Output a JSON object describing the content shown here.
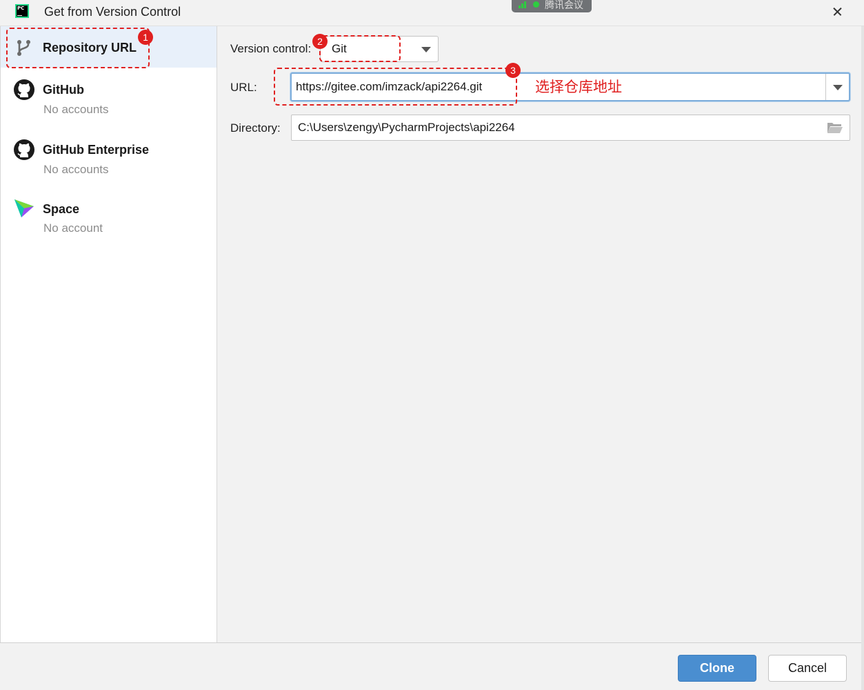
{
  "window": {
    "title": "Get from Version Control",
    "app_icon_text": "PC"
  },
  "overlay": {
    "meeting_label": "腾讯会议"
  },
  "sidebar": {
    "items": [
      {
        "label": "Repository URL",
        "sub": "",
        "icon": "vcs-branch-icon",
        "selected": true
      },
      {
        "label": "GitHub",
        "sub": "No accounts",
        "icon": "github-icon",
        "selected": false
      },
      {
        "label": "GitHub Enterprise",
        "sub": "No accounts",
        "icon": "github-icon",
        "selected": false
      },
      {
        "label": "Space",
        "sub": "No account",
        "icon": "space-icon",
        "selected": false
      }
    ]
  },
  "form": {
    "version_control_label": "Version control:",
    "version_control_value": "Git",
    "url_label": "URL:",
    "url_value": "https://gitee.com/imzack/api2264.git",
    "directory_label": "Directory:",
    "directory_value": "C:\\Users\\zengy\\PycharmProjects\\api2264"
  },
  "annotations": {
    "markers": [
      "1",
      "2",
      "3"
    ],
    "url_note": "选择仓库地址",
    "color": "#e02020"
  },
  "buttons": {
    "clone": "Clone",
    "cancel": "Cancel"
  },
  "colors": {
    "primary_button": "#4a8ed0",
    "selection": "#e8f0fa",
    "focus_border": "#7eaedb"
  }
}
